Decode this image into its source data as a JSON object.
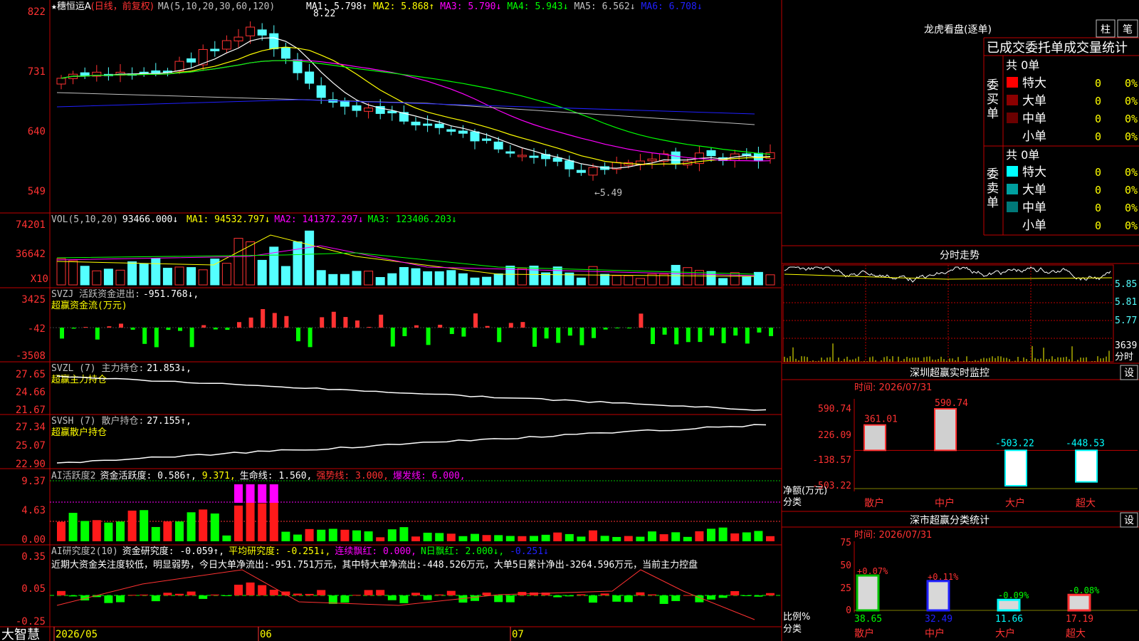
{
  "app": {
    "brand": "大智慧"
  },
  "stock": {
    "name": "穗恒运A",
    "period": "(日线，前复权)"
  },
  "price_panel": {
    "y_ticks": [
      "822",
      "731",
      "640",
      "549"
    ],
    "ma_title": "MA(5,10,20,30,60,120)",
    "ma_items": [
      {
        "label": "MA1:",
        "value": "5.798↑",
        "color": "#ffffff"
      },
      {
        "label": "MA2:",
        "value": "5.868↑",
        "color": "#ffff00"
      },
      {
        "label": "MA3:",
        "value": "5.790↓",
        "color": "#ff00ff"
      },
      {
        "label": "MA4:",
        "value": "5.943↓",
        "color": "#00ff00"
      },
      {
        "label": "MA5:",
        "value": "6.562↓",
        "color": "#c0c0c0"
      },
      {
        "label": "MA6:",
        "value": "6.708↓",
        "color": "#2020ff"
      }
    ],
    "high_marker": "8.22",
    "low_marker": "←5.49"
  },
  "vol_panel": {
    "title": "VOL(5,10,20)",
    "value": "93466.000↓",
    "ma_items": [
      {
        "label": "MA1:",
        "value": "94532.797↓",
        "color": "#ffff00"
      },
      {
        "label": "MA2:",
        "value": "141372.297↓",
        "color": "#ff00ff"
      },
      {
        "label": "MA3:",
        "value": "123406.203↓",
        "color": "#00ff00"
      }
    ],
    "y_ticks": [
      "74201",
      "36642"
    ],
    "unit": "X10"
  },
  "svzj_panel": {
    "title": "SVZJ  活跃资金进出:",
    "value": "-951.768↓,",
    "subtitle": "超赢资金流(万元)",
    "y_ticks": [
      "3425",
      "-42",
      "-3508"
    ]
  },
  "svzl_panel": {
    "title": "SVZL (7) 主力持仓:",
    "value": "21.853↓,",
    "subtitle": "超赢主力持仓",
    "y_ticks": [
      "27.65",
      "24.66",
      "21.67"
    ]
  },
  "svsh_panel": {
    "title": "SVSH (7) 散户持仓:",
    "value": "27.155↑,",
    "subtitle": "超赢散户持仓",
    "y_ticks": [
      "27.34",
      "25.07",
      "22.90"
    ]
  },
  "ai1_panel": {
    "title": "AI活跃度2",
    "items": [
      {
        "label": "资金活跃度:",
        "value": "0.586↑,",
        "color": "#ffffff"
      },
      {
        "label": "",
        "value": "9.371,",
        "color": "#ffff00"
      },
      {
        "label": "生命线:",
        "value": "1.560,",
        "color": "#ffffff"
      },
      {
        "label": "强势线:",
        "value": "3.000,",
        "color": "#ff3030"
      },
      {
        "label": "爆发线:",
        "value": "6.000,",
        "color": "#ff00ff"
      }
    ],
    "y_ticks": [
      "9.37",
      "4.63",
      "0.00"
    ]
  },
  "ai2_panel": {
    "title": "AI研究度2(10)",
    "items": [
      {
        "label": "资金研究度:",
        "value": "-0.059↑,",
        "color": "#ffffff"
      },
      {
        "label": "平均研究度:",
        "value": "-0.251↓,",
        "color": "#ffff00"
      },
      {
        "label": "连续飘红:",
        "value": "0.000,",
        "color": "#ff00ff"
      },
      {
        "label": "N日飘红:",
        "value": "2.000↓,",
        "color": "#00ff00"
      },
      {
        "label": "",
        "value": "-0.251↓",
        "color": "#2020ff"
      }
    ],
    "comment": "近期大资金关注度较低，明显弱势，今日大单净流出:-951.751万元，其中特大单净流出:-448.526万元，大单5日累计净出-3264.596万元，当前主力控盘",
    "y_ticks": [
      "0.35",
      "0.05",
      "-0.25"
    ]
  },
  "date_axis": [
    "2026/05",
    "06",
    "07"
  ],
  "lhb": {
    "title": "龙虎看盘(逐单)",
    "btn_a": "柱",
    "btn_b": "笔",
    "header": "已成交委托单成交量统计",
    "buy_label": "委买单",
    "sell_label": "委卖单",
    "buy_total": "共 0单",
    "sell_total": "共 0单",
    "buy_rows": [
      {
        "name": "特大",
        "count": "0",
        "pct": "0%",
        "color": "#ff0000"
      },
      {
        "name": "大单",
        "count": "0",
        "pct": "0%",
        "color": "#8b0000"
      },
      {
        "name": "中单",
        "count": "0",
        "pct": "0%",
        "color": "#6b0000"
      },
      {
        "name": "小单",
        "count": "0",
        "pct": "0%",
        "color": ""
      }
    ],
    "sell_rows": [
      {
        "name": "特大",
        "count": "0",
        "pct": "0%",
        "color": "#00ffff"
      },
      {
        "name": "大单",
        "count": "0",
        "pct": "0%",
        "color": "#00a0a0"
      },
      {
        "name": "中单",
        "count": "0",
        "pct": "0%",
        "color": "#007878"
      },
      {
        "name": "小单",
        "count": "0",
        "pct": "0%",
        "color": ""
      }
    ]
  },
  "fenshi": {
    "title": "分时走势",
    "prices": [
      "5.85",
      "5.81",
      "5.77"
    ],
    "vol_label": "3639",
    "vol_unit": "分时"
  },
  "monitor": {
    "title": "深圳超赢实时监控",
    "btn": "设",
    "time": "时间: 2026/07/31",
    "y_ticks": [
      "590.74",
      "226.09",
      "-138.57",
      "-503.22"
    ],
    "ylabel": "净额(万元)",
    "xlabel": "分类",
    "bars": [
      {
        "name": "散户",
        "value": 361.01,
        "label": "361.01"
      },
      {
        "name": "中户",
        "value": 590.74,
        "label": "590.74"
      },
      {
        "name": "大户",
        "value": -503.22,
        "label": "-503.22"
      },
      {
        "name": "超大",
        "value": -448.53,
        "label": "-448.53"
      }
    ]
  },
  "stats": {
    "title": "深市超赢分类统计",
    "btn": "设",
    "time": "时间: 2026/07/31",
    "y_ticks": [
      "75",
      "50",
      "25",
      "0"
    ],
    "ylabel": "比例%",
    "xlabel": "分类",
    "bars": [
      {
        "name": "散户",
        "value": 38.65,
        "label": "38.65",
        "change": "+0.07%"
      },
      {
        "name": "中户",
        "value": 32.49,
        "label": "32.49",
        "change": "+0.11%"
      },
      {
        "name": "大户",
        "value": 11.66,
        "label": "11.66",
        "change": "-0.09%"
      },
      {
        "name": "超大",
        "value": 17.19,
        "label": "17.19",
        "change": "-0.08%"
      }
    ]
  },
  "colors": {
    "up": "#ff3232",
    "down": "#54ffff",
    "green": "#00ff00",
    "frame": "#c00000"
  }
}
